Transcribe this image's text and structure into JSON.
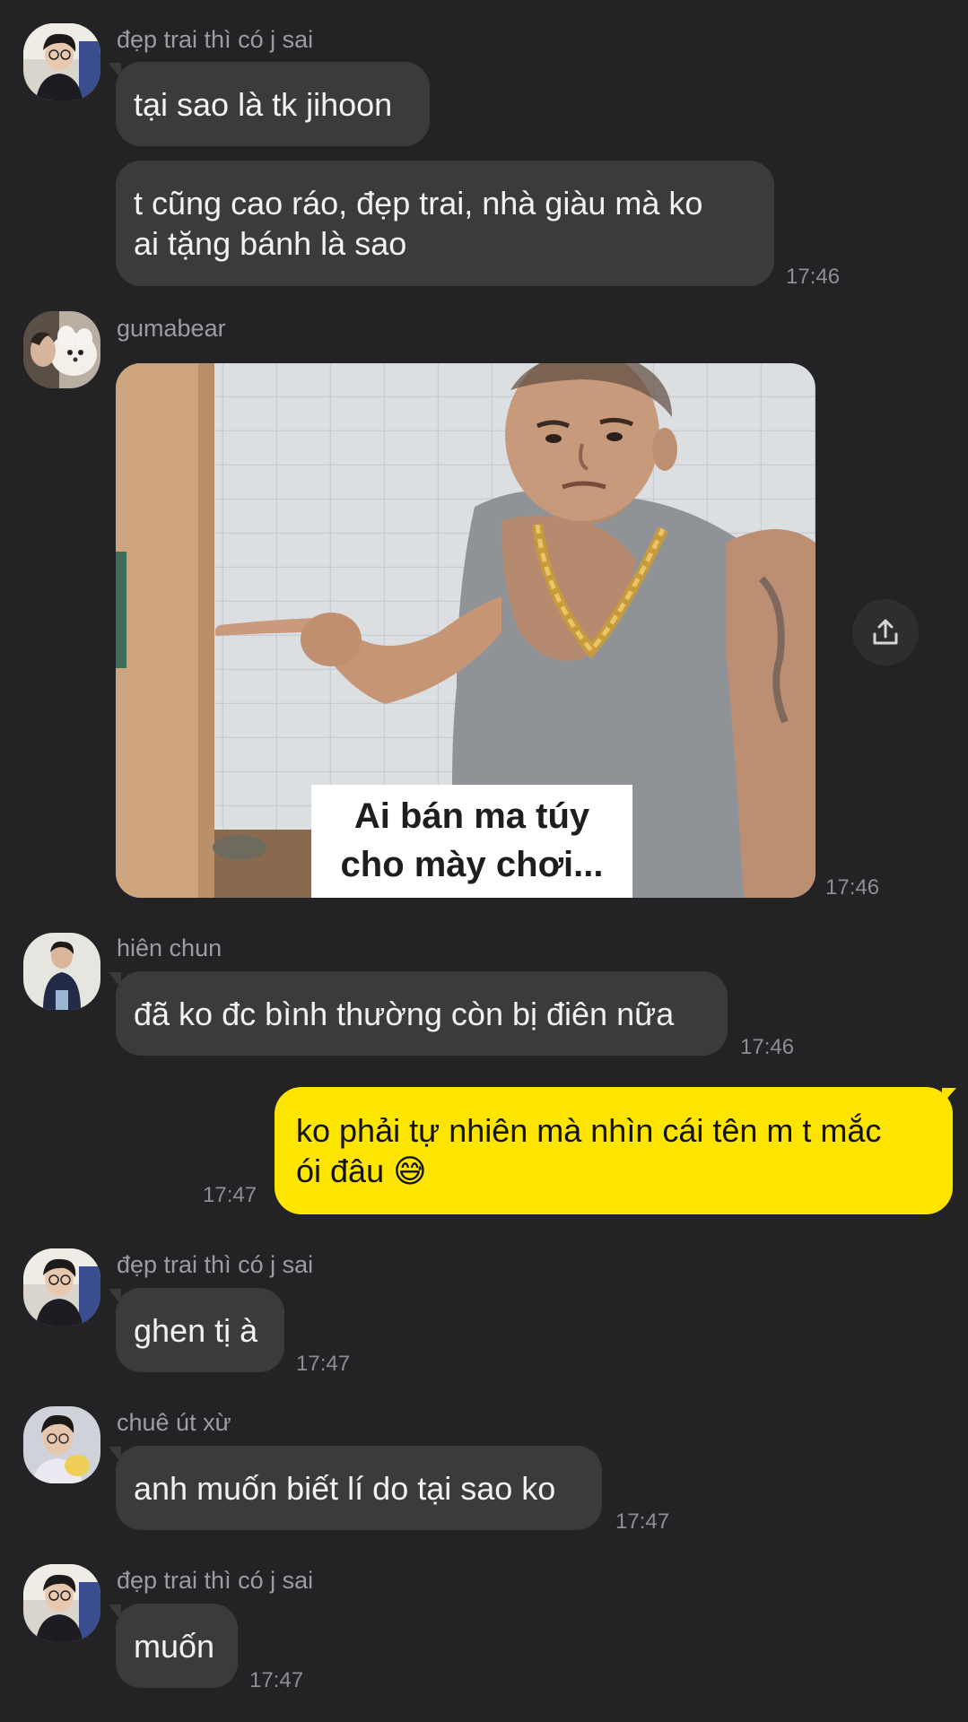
{
  "messages": [
    {
      "sender": "đẹp trai thì có j sai",
      "lines": [
        "tại sao là tk jihoon"
      ]
    },
    {
      "lines": [
        "t cũng cao ráo, đẹp trai, nhà giàu mà ko",
        "ai tặng bánh là sao"
      ],
      "time": "17:46"
    },
    {
      "sender": "gumabear",
      "image_caption": [
        "Ai bán ma túy",
        "cho mày chơi..."
      ],
      "time": "17:46"
    },
    {
      "sender": "hiên chun",
      "lines": [
        "đã ko đc bình thường còn bị điên nữa"
      ],
      "time": "17:46"
    },
    {
      "own": true,
      "lines": [
        "ko phải tự nhiên mà nhìn cái tên m t mắc",
        "ói đâu 😅"
      ],
      "time": "17:47"
    },
    {
      "sender": "đẹp trai thì có j sai",
      "lines": [
        "ghen tị à"
      ],
      "time": "17:47"
    },
    {
      "sender": "chuê út xừ",
      "lines": [
        "anh muốn biết lí do tại sao ko"
      ],
      "time": "17:47"
    },
    {
      "sender": "đẹp trai thì có j sai",
      "lines": [
        "muốn"
      ],
      "time": "17:47"
    }
  ],
  "icons": {
    "share": "share-icon"
  },
  "colors": {
    "background": "#232325",
    "bubble": "#3b3b3e",
    "own_bubble": "#fee500"
  }
}
